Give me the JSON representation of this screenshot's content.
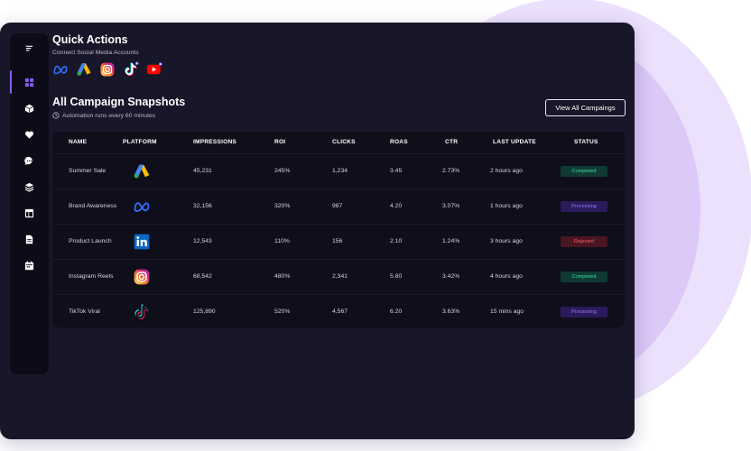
{
  "quick_actions": {
    "title": "Quick Actions",
    "subtitle": "Connect Social Media Accounts",
    "icons": [
      "meta-icon",
      "google-ads-icon",
      "instagram-icon",
      "tiktok-icon",
      "youtube-icon"
    ]
  },
  "snapshots": {
    "title": "All Campaign Snapshots",
    "subtitle": "Automation runs every 60 minutes",
    "view_all_label": "View All Campaings"
  },
  "table": {
    "headers": [
      "NAME",
      "PLATFORM",
      "IMPRESSIONS",
      "ROI",
      "CLICKS",
      "ROAS",
      "CTR",
      "LAST UPDATE",
      "STATUS"
    ],
    "rows": [
      {
        "name": "Summer Sale",
        "platform": "google-ads-icon",
        "impressions": "45,231",
        "roi": "245%",
        "clicks": "1,234",
        "roas": "3.45",
        "ctr": "2.73%",
        "last_update": "2 hours ago",
        "status": "Completed"
      },
      {
        "name": "Brand Awareness",
        "platform": "meta-icon",
        "impressions": "32,156",
        "roi": "320%",
        "clicks": "987",
        "roas": "4.20",
        "ctr": "3.07%",
        "last_update": "1 hours ago",
        "status": "Processing"
      },
      {
        "name": "Product Launch",
        "platform": "linkedin-icon",
        "impressions": "12,543",
        "roi": "110%",
        "clicks": "156",
        "roas": "2.10",
        "ctr": "1.24%",
        "last_update": "3 hours ago",
        "status": "Rejected"
      },
      {
        "name": "Instagram Reels",
        "platform": "instagram-icon",
        "impressions": "68,542",
        "roi": "480%",
        "clicks": "2,341",
        "roas": "5.80",
        "ctr": "3.42%",
        "last_update": "4 hours ago",
        "status": "Completed"
      },
      {
        "name": "TikTok Viral",
        "platform": "tiktok-icon",
        "impressions": "125,890",
        "roi": "520%",
        "clicks": "4,567",
        "roas": "6.20",
        "ctr": "3.63%",
        "last_update": "15 mins ago",
        "status": "Processing"
      }
    ]
  },
  "sidebar": {
    "items": [
      "menu-icon",
      "dashboard-icon",
      "cube-icon",
      "heart-icon",
      "chat-icon",
      "layers-icon",
      "layout-icon",
      "document-icon",
      "calendar-icon"
    ]
  },
  "colors": {
    "accent": "#8b5cf6",
    "completed": "#3ddca1",
    "processing": "#9b7bff",
    "rejected": "#ff5d6d"
  }
}
